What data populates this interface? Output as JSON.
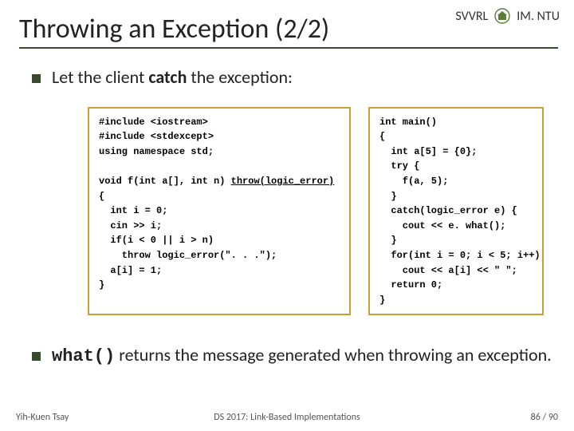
{
  "header": {
    "org_left": "SVVRL",
    "at": "@",
    "org_right": "IM. NTU"
  },
  "title": "Throwing an Exception (2/2)",
  "bullets": {
    "first_pre": "Let the client ",
    "first_strong": "catch",
    "first_post": " the exception:",
    "second_mono": "what()",
    "second_rest": " returns the message generated when throwing an exception."
  },
  "code": {
    "left_block1": "#include <iostream>\n#include <stdexcept>\nusing namespace std;",
    "left_sig_pre": "void f(int a[], int n) ",
    "left_sig_u": "throw(logic_error)",
    "left_block2": "{\n  int i = 0;\n  cin >> i;\n  if(i < 0 || i > n)\n    throw logic_error(\". . .\");\n  a[i] = 1;\n}",
    "right": "int main()\n{\n  int a[5] = {0};\n  try {\n    f(a, 5);\n  }\n  catch(logic_error e) {\n    cout << e. what();\n  }\n  for(int i = 0; i < 5; i++)\n    cout << a[i] << \" \";\n  return 0;\n}"
  },
  "footer": {
    "author": "Yih-Kuen Tsay",
    "course": "DS 2017: Link-Based Implementations",
    "page": "86 / 90"
  }
}
